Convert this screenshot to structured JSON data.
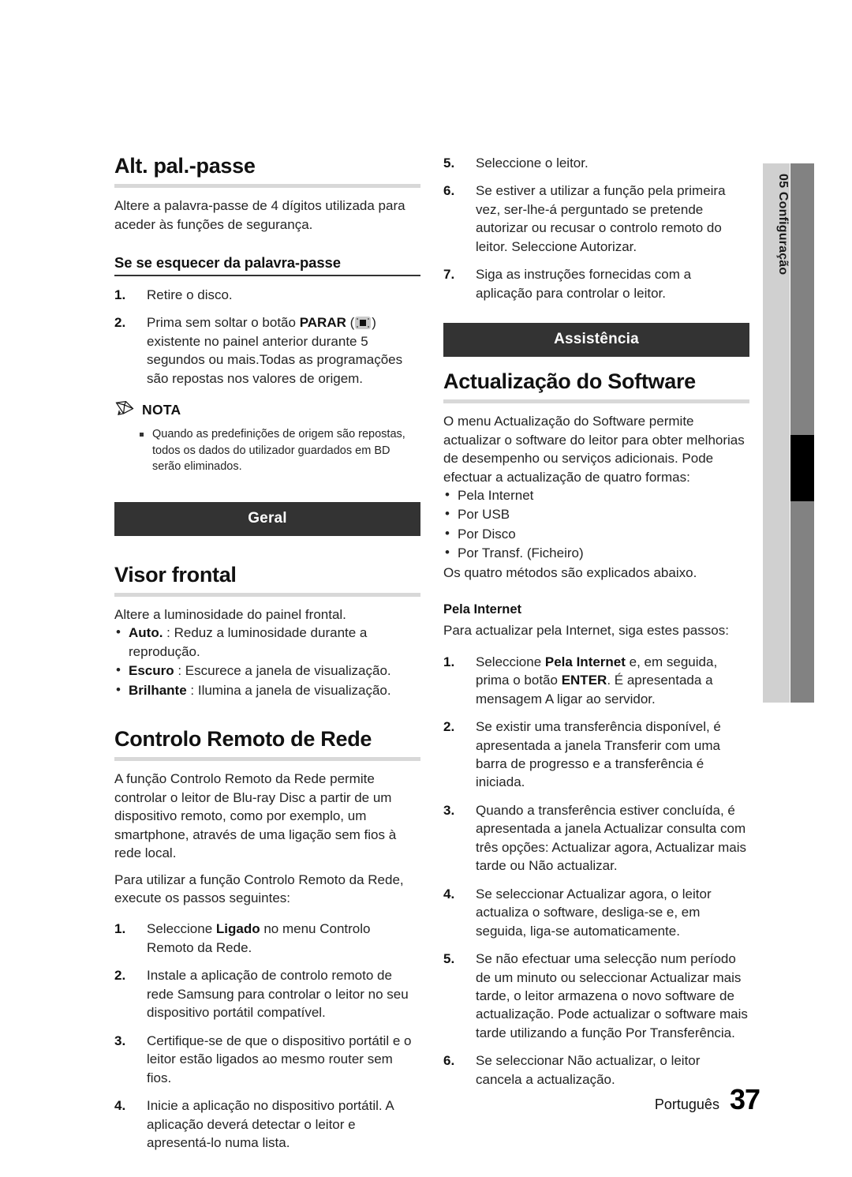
{
  "page": {
    "language_label": "Português",
    "page_number": "37"
  },
  "side_tab": {
    "chapter_number": "05",
    "chapter_title": "Configuração",
    "combined": "05   Configuração"
  },
  "left_column": {
    "heading": "Alt. pal.-passe",
    "intro": "Altere a palavra-passe de 4 dígitos utilizada para aceder às funções de segurança.",
    "subheading": "Se se esquecer da palavra-passe",
    "steps": [
      {
        "num": "1.",
        "text": "Retire o disco."
      },
      {
        "num": "2.",
        "text_before": "Prima sem soltar o botão ",
        "bold": "PARAR",
        "icon": "stop-icon",
        "text_after": " existente no painel anterior durante 5 segundos ou mais.Todas as programações são repostas nos valores de origem."
      }
    ],
    "note": {
      "icon": "pencil-icon",
      "label": "NOTA",
      "items": [
        "Quando as predefinições de origem são repostas, todos os dados do utilizador guardados em BD serão eliminados."
      ]
    },
    "banner": "Geral",
    "visor": {
      "heading": "Visor frontal",
      "intro": "Altere a luminosidade do painel frontal.",
      "options": [
        {
          "bold": "Auto.",
          "rest": " : Reduz a luminosidade durante a reprodução."
        },
        {
          "bold": "Escuro",
          "rest": " : Escurece a janela de visualização."
        },
        {
          "bold": "Brilhante",
          "rest": " : Ilumina a janela de visualização."
        }
      ]
    },
    "remote": {
      "heading": "Controlo Remoto de Rede",
      "paragraph1": "A função Controlo Remoto da Rede permite controlar o leitor de Blu-ray Disc a partir de um dispositivo remoto, como por exemplo, um smartphone, através de uma ligação sem fios à rede local.",
      "paragraph2": "Para utilizar a função Controlo Remoto da Rede, execute os passos seguintes:",
      "steps": [
        {
          "num": "1.",
          "text_before": "Seleccione ",
          "bold": "Ligado",
          "text_after": " no menu Controlo Remoto da Rede."
        },
        {
          "num": "2.",
          "text_before": "Instale a aplicação de controlo remoto de rede Samsung para controlar o leitor no seu dispositivo portátil compatível.",
          "bold": "",
          "text_after": ""
        },
        {
          "num": "3.",
          "text_before": "Certifique-se de que o dispositivo portátil e o leitor estão ligados ao mesmo router sem fios.",
          "bold": "",
          "text_after": ""
        },
        {
          "num": "4.",
          "text_before": "Inicie a aplicação no dispositivo portátil. A aplicação deverá detectar o leitor e apresentá-lo numa lista.",
          "bold": "",
          "text_after": ""
        }
      ]
    }
  },
  "right_column": {
    "continued_steps": [
      {
        "num": "5.",
        "text": "Seleccione o leitor."
      },
      {
        "num": "6.",
        "text": "Se estiver a utilizar a função pela primeira vez, ser-lhe-á perguntado se pretende autorizar ou recusar o controlo remoto do leitor. Seleccione Autorizar."
      },
      {
        "num": "7.",
        "text": "Siga as instruções fornecidas com a aplicação para controlar o leitor."
      }
    ],
    "banner": "Assistência",
    "software": {
      "heading": "Actualização do Software",
      "intro": "O menu Actualização do Software permite actualizar o software do leitor para obter melhorias de desempenho ou serviços adicionais. Pode efectuar a actualização de quatro formas:",
      "methods": [
        "Pela Internet",
        "Por USB",
        "Por Disco",
        "Por Transf. (Ficheiro)"
      ],
      "closing": "Os quatro métodos são explicados abaixo."
    },
    "internet": {
      "subheading": "Pela Internet",
      "intro": "Para actualizar pela Internet, siga estes passos:",
      "steps": [
        {
          "num": "1.",
          "seg1": "Seleccione ",
          "bold1": "Pela Internet",
          "seg2": " e, em seguida, prima o botão ",
          "bold2": "ENTER",
          "seg3": ". É apresentada a mensagem A ligar ao servidor."
        },
        {
          "num": "2.",
          "seg1": "Se existir uma transferência disponível, é apresentada a janela Transferir com uma barra de progresso e a transferência é iniciada.",
          "bold1": "",
          "seg2": "",
          "bold2": "",
          "seg3": ""
        },
        {
          "num": "3.",
          "seg1": "Quando a transferência estiver concluída, é apresentada a janela Actualizar consulta com três opções: Actualizar agora, Actualizar mais tarde ou Não actualizar.",
          "bold1": "",
          "seg2": "",
          "bold2": "",
          "seg3": ""
        },
        {
          "num": "4.",
          "seg1": "Se seleccionar Actualizar agora, o leitor actualiza o software, desliga-se e, em seguida, liga-se automaticamente.",
          "bold1": "",
          "seg2": "",
          "bold2": "",
          "seg3": ""
        },
        {
          "num": "5.",
          "seg1": "Se não efectuar uma selecção num período de um minuto ou seleccionar Actualizar mais tarde, o leitor armazena o novo software de actualização. Pode actualizar o software mais tarde utilizando a função Por Transferência.",
          "bold1": "",
          "seg2": "",
          "bold2": "",
          "seg3": ""
        },
        {
          "num": "6.",
          "seg1": "Se seleccionar Não actualizar, o leitor cancela a actualização.",
          "bold1": "",
          "seg2": "",
          "bold2": "",
          "seg3": ""
        }
      ]
    }
  }
}
